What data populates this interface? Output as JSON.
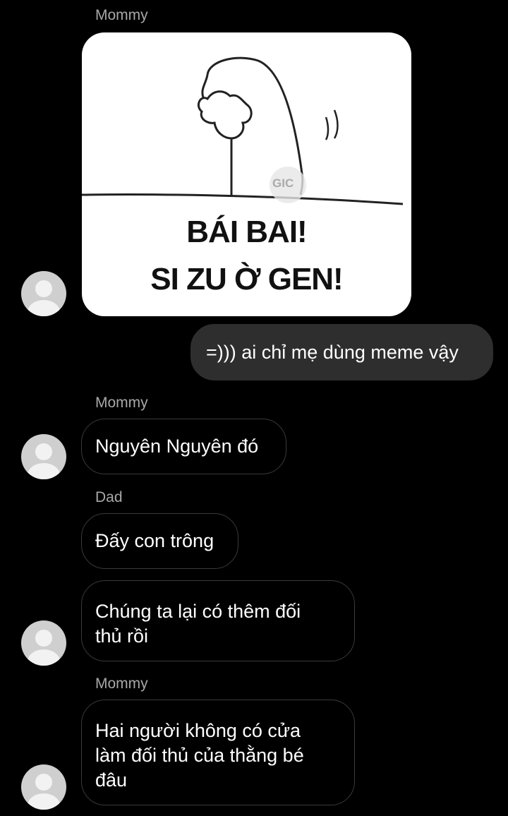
{
  "messages": [
    {
      "sender": "Mommy",
      "type": "image",
      "meme_line1": "BÁI BAI!",
      "meme_line2": "SI ZU Ờ GEN!",
      "watermark": "GIC"
    },
    {
      "sender": "",
      "type": "text",
      "direction": "outgoing",
      "text": "=))) ai chỉ mẹ dùng meme vậy"
    },
    {
      "sender": "Mommy",
      "type": "text",
      "text": "Nguyên Nguyên đó"
    },
    {
      "sender": "Dad",
      "type": "text",
      "text": "Đấy con trông"
    },
    {
      "sender": "",
      "type": "text",
      "text_lines": [
        "Chúng ta lại có thêm đối",
        "thủ rồi"
      ]
    },
    {
      "sender": "Mommy",
      "type": "text",
      "text_lines": [
        "Hai người không có cửa",
        "làm đối thủ của thằng bé",
        "đâu"
      ]
    }
  ],
  "colors": {
    "background": "#000000",
    "outgoing_bubble": "#2e2e2e",
    "incoming_border": "#3a3a3a",
    "sender_label": "#a8a8a8",
    "avatar": "#cfcfcf"
  },
  "icons": {
    "avatar": "default-user-avatar-icon"
  }
}
